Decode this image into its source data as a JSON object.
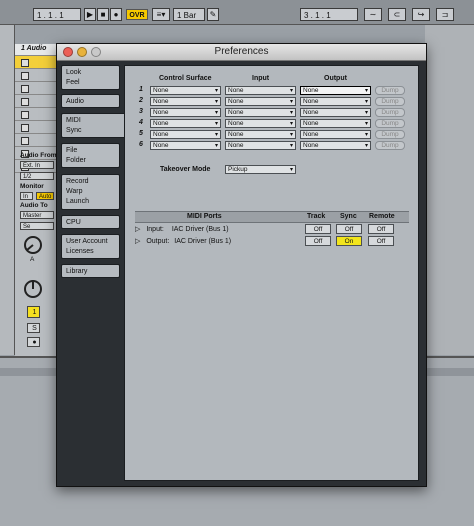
{
  "top_bar": {
    "position": "1 .  1 .  1",
    "ovr": "OVR",
    "quant": "1 Bar",
    "loop_pos": "3 .  1 .  1"
  },
  "bg": {
    "track_name": "1 Audio",
    "audio_from": "Audio From",
    "ext_in": "Ext. In",
    "chan": "1/2",
    "monitor": "Monitor",
    "mon_in": "In",
    "mon_auto": "Auto",
    "audio_to": "Audio To",
    "master": "Master",
    "sends": "Se",
    "knob_a": "A",
    "track_num": "1",
    "solo": "S"
  },
  "window": {
    "title": "Preferences"
  },
  "nav": [
    [
      "Look",
      "Feel"
    ],
    [
      "Audio"
    ],
    [
      "MIDI",
      "Sync"
    ],
    [
      "File",
      "Folder"
    ],
    [
      "Record",
      "Warp",
      "Launch"
    ],
    [
      "CPU"
    ],
    [
      "User Account",
      "Licenses"
    ],
    [
      "Library"
    ]
  ],
  "midi": {
    "col_control_surface": "Control Surface",
    "col_input": "Input",
    "col_output": "Output",
    "rows": [
      {
        "num": "1",
        "cs": "None",
        "in": "None",
        "out": "None",
        "dump": "Dump"
      },
      {
        "num": "2",
        "cs": "None",
        "in": "None",
        "out": "None",
        "dump": "Dump"
      },
      {
        "num": "3",
        "cs": "None",
        "in": "None",
        "out": "None",
        "dump": "Dump"
      },
      {
        "num": "4",
        "cs": "None",
        "in": "None",
        "out": "None",
        "dump": "Dump"
      },
      {
        "num": "5",
        "cs": "None",
        "in": "None",
        "out": "None",
        "dump": "Dump"
      },
      {
        "num": "6",
        "cs": "None",
        "in": "None",
        "out": "None",
        "dump": "Dump"
      }
    ],
    "takeover_label": "Takeover Mode",
    "takeover_value": "Pickup",
    "ports_header": "MIDI Ports",
    "track_header": "Track",
    "sync_header": "Sync",
    "remote_header": "Remote",
    "ports": [
      {
        "dir": "Input:",
        "name": "IAC Driver (Bus 1)",
        "track": "Off",
        "sync": "Off",
        "remote": "Off",
        "sync_on": false
      },
      {
        "dir": "Output:",
        "name": "IAC Driver (Bus 1)",
        "track": "Off",
        "sync": "On",
        "remote": "Off",
        "sync_on": true
      }
    ]
  },
  "colors": {
    "accent_yellow": "#f2e51c",
    "ovr_yellow": "#f5c800",
    "panel": "#b3b8bd",
    "window_bg": "#2b2f33"
  }
}
